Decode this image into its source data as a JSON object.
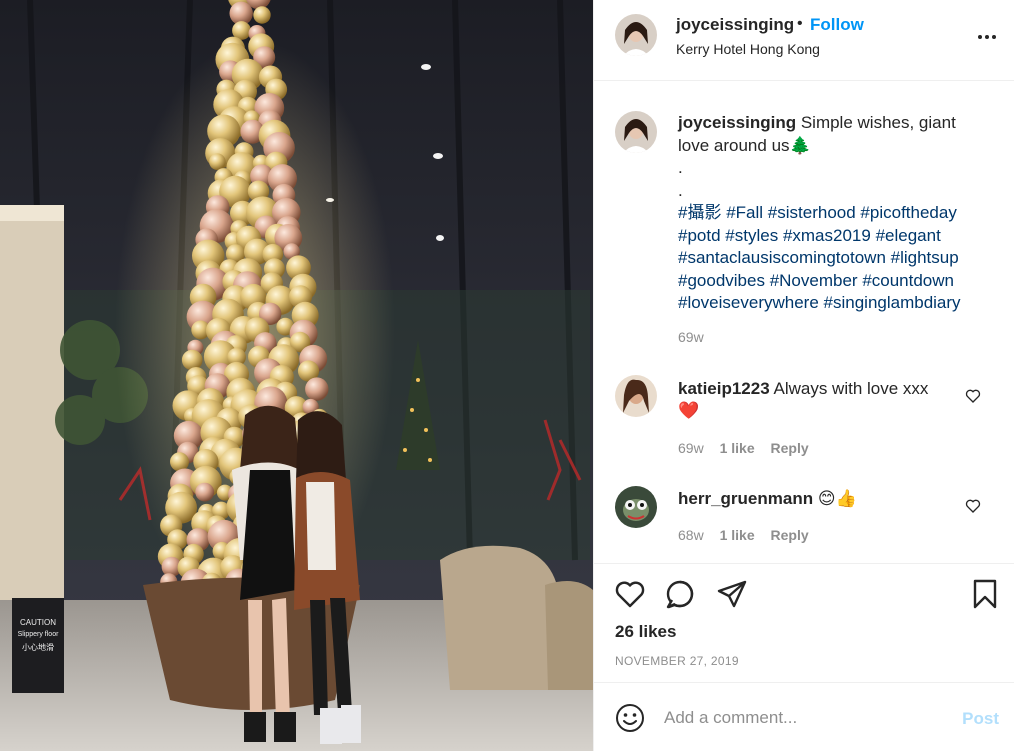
{
  "post": {
    "username": "joyceissinging",
    "dot": "•",
    "follow_label": "Follow",
    "location": "Kerry Hotel Hong Kong",
    "more_icon": "more-options-icon"
  },
  "caption": {
    "username": "joyceissinging",
    "text": "Simple wishes, giant love around us",
    "emoji": "🌲",
    "dots": [
      ".",
      "."
    ],
    "hashtags": [
      "#攝影",
      "#Fall",
      "#sisterhood",
      "#picoftheday",
      "#potd",
      "#styles",
      "#xmas2019",
      "#elegant",
      "#santaclausiscomingtotown",
      "#lightsup",
      "#goodvibes",
      "#November",
      "#countdown",
      "#loveiseverywhere",
      "#singinglambdiary"
    ],
    "time": "69w"
  },
  "comments": [
    {
      "username": "katieip1223",
      "text": "Always with love xxx",
      "emoji": "❤️",
      "time": "69w",
      "likes": "1 like",
      "reply_label": "Reply"
    },
    {
      "username": "herr_gruenmann",
      "text": "",
      "emoji": "😊👍",
      "time": "68w",
      "likes": "1 like",
      "reply_label": "Reply"
    }
  ],
  "actions": {
    "icons": [
      "heart-icon",
      "comment-icon",
      "share-icon",
      "bookmark-icon"
    ],
    "likes": "26 likes",
    "date": "NOVEMBER 27, 2019"
  },
  "add_comment": {
    "placeholder": "Add a comment...",
    "post_label": "Post"
  },
  "photo_sign": {
    "line1": "CAUTION",
    "line2": "Slippery floor",
    "line3": "小心地滑"
  },
  "colors": {
    "link": "#0095f6",
    "hashtag": "#00376b",
    "muted": "#8e8e8e",
    "post_disabled": "#b2dffc",
    "like_red": "#ed4956"
  }
}
